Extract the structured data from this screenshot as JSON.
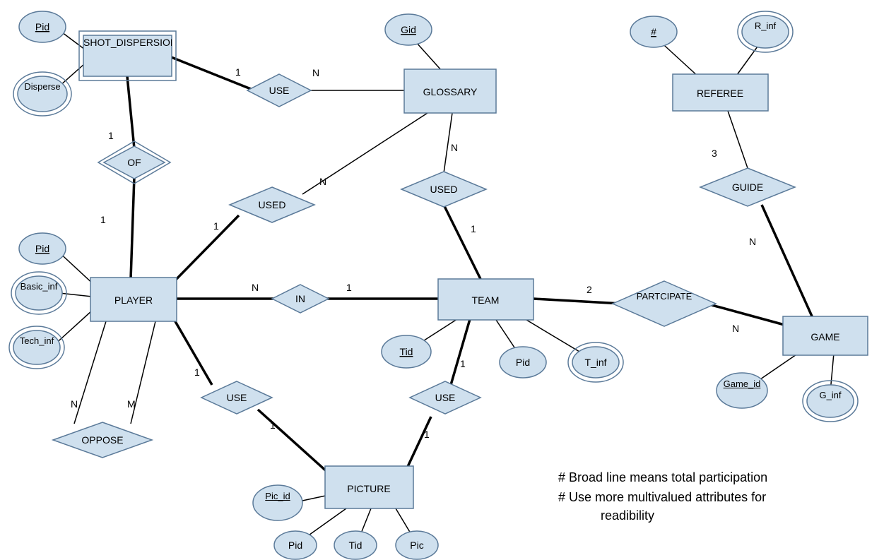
{
  "entities": {
    "shot_dispersion": "SHOT_DISPERSION",
    "player": "PLAYER",
    "glossary": "GLOSSARY",
    "team": "TEAM",
    "referee": "REFEREE",
    "game": "GAME",
    "picture": "PICTURE"
  },
  "relationships": {
    "use1": "USE",
    "of": "OF",
    "used1": "USED",
    "used2": "USED",
    "in": "IN",
    "oppose": "OPPOSE",
    "use2": "USE",
    "use3": "USE",
    "participate": "PARTCIPATE",
    "guide": "GUIDE"
  },
  "attributes": {
    "sd_pid": "Pid",
    "sd_disperse": "Disperse",
    "gl_gid": "Gid",
    "pl_pid": "Pid",
    "pl_basic": "Basic_inf",
    "pl_tech": "Tech_inf",
    "tm_tid": "Tid",
    "tm_pid": "Pid",
    "tm_tinf": "T_inf",
    "ref_num": "#",
    "ref_rinf": "R_inf",
    "gm_id": "Game_id",
    "gm_ginf": "G_inf",
    "pic_id": "Pic_id",
    "pic_pid": "Pid",
    "pic_tid": "Tid",
    "pic_pic": "Pic"
  },
  "cardinalities": {
    "sd_use": "1",
    "gl_use": "N",
    "sd_of": "1",
    "pl_of": "1",
    "pl_used": "1",
    "gl_used1": "N",
    "gl_used2": "N",
    "tm_used": "1",
    "pl_in": "N",
    "tm_in": "1",
    "oppose_n": "N",
    "oppose_m": "M",
    "pl_use_pic": "1",
    "pic_use_pl": "1",
    "tm_use_pic": "1",
    "pic_use_tm": "1",
    "tm_part": "2",
    "gm_part": "N",
    "ref_guide": "3",
    "gm_guide": "N"
  },
  "notes": {
    "l1": "# Broad line means  total participation",
    "l2": "# Use more multivalued attributes for",
    "l3": "readibility"
  }
}
